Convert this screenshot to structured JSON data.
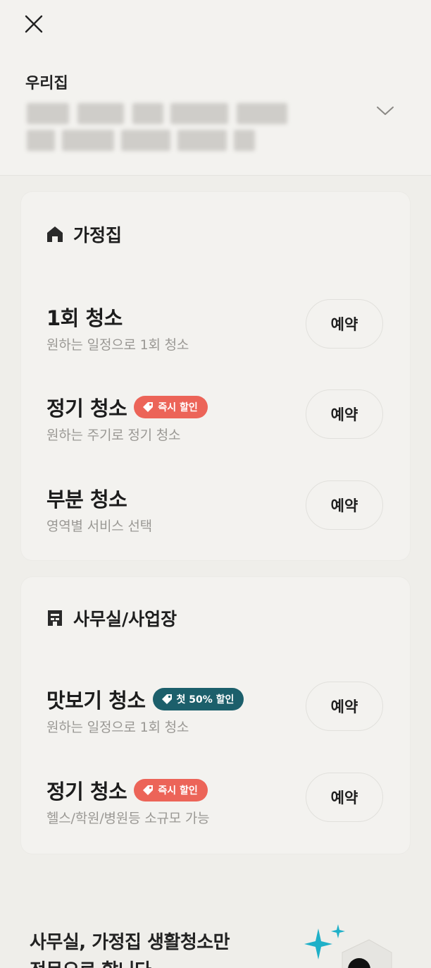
{
  "header": {
    "close_icon": "close-icon",
    "address_title": "우리집",
    "expand_icon": "chevron-down-icon"
  },
  "home_section": {
    "title": "가정집",
    "icon": "home-icon",
    "services": [
      {
        "title": "1회 청소",
        "subtitle": "원하는 일정으로 1회 청소",
        "badge": "",
        "reserve_label": "예약"
      },
      {
        "title": "정기 청소",
        "subtitle": "원하는 주기로 정기 청소",
        "badge": "즉시 할인",
        "reserve_label": "예약"
      },
      {
        "title": "부분 청소",
        "subtitle": "영역별 서비스 선택",
        "badge": "",
        "reserve_label": "예약"
      }
    ]
  },
  "office_section": {
    "title": "사무실/사업장",
    "icon": "office-icon",
    "services": [
      {
        "title": "맛보기 청소",
        "subtitle": "원하는 일정으로 1회 청소",
        "badge": "첫 50% 할인",
        "reserve_label": "예약"
      },
      {
        "title": "정기 청소",
        "subtitle": "헬스/학원/병원등 소규모 가능",
        "badge": "즉시 할인",
        "reserve_label": "예약"
      }
    ]
  },
  "promo": {
    "line1": "사무실, 가정집 생활청소만",
    "line2": "전문으로 합니다"
  },
  "colors": {
    "background": "#efeeea",
    "card": "#f3f2ef",
    "badge_red": "#ec6458",
    "badge_teal": "#1c5f6b",
    "sparkle": "#1fb0c8"
  }
}
